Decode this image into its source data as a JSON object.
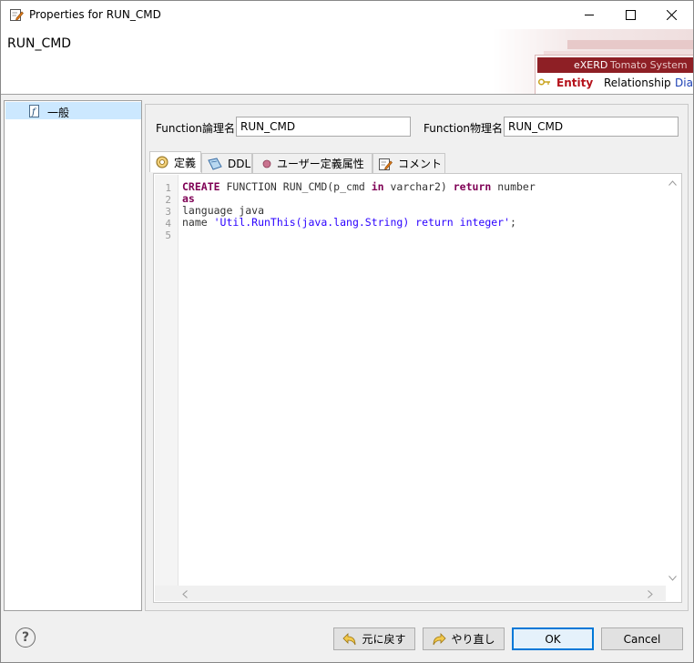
{
  "window": {
    "title": "Properties for RUN_CMD"
  },
  "header": {
    "title": "RUN_CMD",
    "banner": {
      "brand": "eXERD",
      "brand_sub": "Tomato System",
      "tab_entity": "Entity",
      "tab_relationship": "Relationship",
      "tab_diagram": "Diag"
    }
  },
  "tree": {
    "items": [
      {
        "label": "一般",
        "icon": "function-icon",
        "selected": true
      }
    ]
  },
  "fields": {
    "logical_label": "Function論理名",
    "logical_value": "RUN_CMD",
    "physical_label": "Function物理名",
    "physical_value": "RUN_CMD"
  },
  "tabs": [
    {
      "label": "定義",
      "icon": "definition-icon",
      "active": true
    },
    {
      "label": "DDL",
      "icon": "ddl-icon",
      "active": false
    },
    {
      "label": "ユーザー定義属性",
      "icon": "user-attr-icon",
      "active": false
    },
    {
      "label": "コメント",
      "icon": "comment-icon",
      "active": false
    }
  ],
  "editor": {
    "line_numbers": [
      "1",
      "2",
      "3",
      "4",
      "5"
    ],
    "lines": [
      "CREATE FUNCTION RUN_CMD(p_cmd in varchar2) return number",
      "as",
      "language java",
      "name 'Util.RunThis(java.lang.String) return integer';",
      ""
    ]
  },
  "buttons": {
    "undo": "元に戻す",
    "redo": "やり直し",
    "ok": "OK",
    "cancel": "Cancel"
  },
  "colors": {
    "accent": "#0078d7",
    "brand_red": "#8e1f25",
    "keyword": "#7f0055",
    "string": "#2a00ff",
    "selection": "#cce8ff"
  }
}
